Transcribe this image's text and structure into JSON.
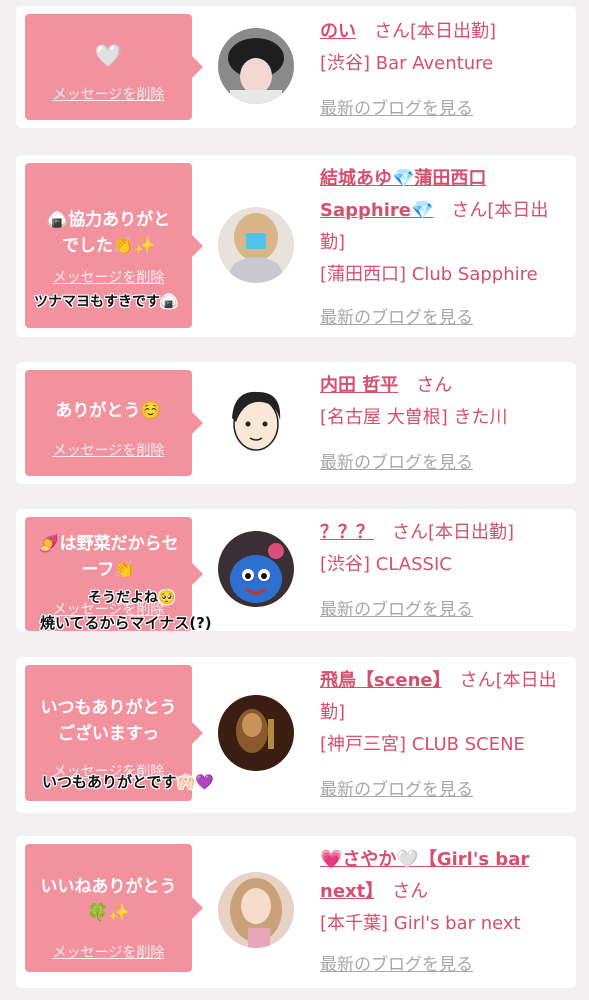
{
  "common": {
    "delete_label": "メッセージを削除",
    "blog_label": "最新のブログを見る"
  },
  "items": [
    {
      "message": "🤍",
      "name": "のい",
      "suffix": "さん[本日出勤]",
      "location": "[渋谷] Bar Aventure",
      "stamp": ""
    },
    {
      "message": "🍙協力ありがとでした👏✨",
      "name": "結城あゆ💎蒲田西口Sapphire💎",
      "suffix": "さん[本日出勤]",
      "location": "[蒲田西口] Club Sapphire",
      "stamp": "ツナマヨもすきです🍙"
    },
    {
      "message": "ありがとう☺️",
      "name": "内田 哲平",
      "suffix": "さん",
      "location": "[名古屋 大曽根] きた川",
      "stamp": ""
    },
    {
      "message": "🍠は野菜だからセーフ👏",
      "name": "？？？",
      "suffix": "さん[本日出勤]",
      "location": "[渋谷] CLASSIC",
      "stamp": "そうだよね🥺",
      "stamp2": "焼いてるからマイナス(?)"
    },
    {
      "message": "いつもありがとうございますっ",
      "name": "飛鳥【scene】",
      "suffix": "さん[本日出勤]",
      "location": "[神戸三宮] CLUB SCENE",
      "stamp": "いつもありがとです🙌🏻💜"
    },
    {
      "message": "いいねありがとう🍀✨",
      "name": "💗さやか🤍【Girl's bar next】",
      "suffix": "さん",
      "location": "[本千葉] Girl's bar next",
      "stamp": ""
    }
  ],
  "colors": {
    "bubble": "#f3929f",
    "name": "#d64f6f",
    "link_gray": "#a8a8a8",
    "background": "#f2f0f1"
  }
}
